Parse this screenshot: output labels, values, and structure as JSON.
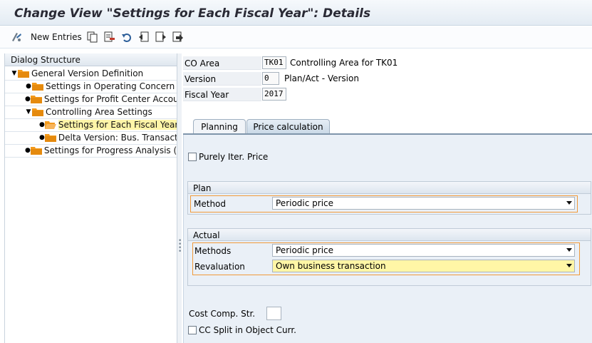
{
  "title": "Change View \"Settings for Each Fiscal Year\": Details",
  "toolbar": {
    "new_entries": "New Entries",
    "icons": [
      "display-change-icon",
      "copy-icon",
      "delete-icon",
      "undo-icon",
      "previous-entry-icon",
      "next-entry-icon",
      "select-icon"
    ]
  },
  "dialog": {
    "header": "Dialog Structure",
    "items": [
      {
        "label": "General Version Definition"
      },
      {
        "label": "Settings in Operating Concern"
      },
      {
        "label": "Settings for Profit Center Accounting"
      },
      {
        "label": "Controlling Area Settings"
      },
      {
        "label": "Settings for Each Fiscal Year"
      },
      {
        "label": "Delta Version: Bus. Transactions"
      },
      {
        "label": "Settings for Progress Analysis (Project/Order)"
      }
    ]
  },
  "header": {
    "co_area_label": "CO Area",
    "co_area_value": "TK01",
    "co_area_desc": "Controlling Area for TK01",
    "version_label": "Version",
    "version_value": "0",
    "version_desc": "Plan/Act - Version",
    "fiscal_year_label": "Fiscal Year",
    "fiscal_year_value": "2017"
  },
  "tabs": [
    {
      "label": "Planning"
    },
    {
      "label": "Price calculation"
    }
  ],
  "tab_active": "Price calculation",
  "purely_iter_price": {
    "label": "Purely Iter. Price",
    "checked": false
  },
  "plan": {
    "title": "Plan",
    "method_label": "Method",
    "method_value": "Periodic price"
  },
  "actual": {
    "title": "Actual",
    "methods_label": "Methods",
    "methods_value": "Periodic price",
    "revaluation_label": "Revaluation",
    "revaluation_value": "Own business transaction"
  },
  "cost_comp": {
    "label": "Cost Comp. Str.",
    "value": ""
  },
  "cc_split": {
    "label": "CC Split in Object Curr.",
    "checked": false
  },
  "colors": {
    "highlight_border": "#f09a3a",
    "selected_row": "#fff5a8",
    "folder": "#f39a1b",
    "panel": "#eaf0f7"
  }
}
